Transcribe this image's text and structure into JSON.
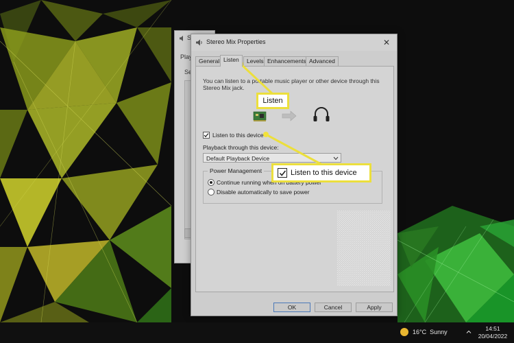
{
  "background_window": {
    "title": "S",
    "tab": "Play",
    "label": "Se"
  },
  "window": {
    "title": "Stereo Mix Properties",
    "close_icon": "close-icon"
  },
  "tabs": [
    {
      "label": "General",
      "active": false
    },
    {
      "label": "Listen",
      "active": true
    },
    {
      "label": "Levels",
      "active": false
    },
    {
      "label": "Enhancements",
      "active": false
    },
    {
      "label": "Advanced",
      "active": false
    }
  ],
  "listen_panel": {
    "description": "You can listen to a portable music player or other device through this Stereo Mix jack.",
    "listen_checkbox_label": "Listen to this device",
    "listen_checked": true,
    "playback_label": "Playback through this device:",
    "playback_value": "Default Playback Device",
    "power_group_title": "Power Management",
    "radio_options": [
      {
        "label": "Continue running when on battery power",
        "selected": true
      },
      {
        "label": "Disable automatically to save power",
        "selected": false
      }
    ]
  },
  "buttons": {
    "ok": "OK",
    "cancel": "Cancel",
    "apply": "Apply"
  },
  "callouts": {
    "listen": "Listen",
    "listen_to_device": "Listen to this device"
  },
  "taskbar": {
    "temperature": "16°C",
    "condition": "Sunny",
    "time": "14:51",
    "date": "20/04/2022"
  },
  "colors": {
    "callout_border": "#ecdf3c",
    "callout_dot": "#f2e23a",
    "wallpaper_yellow": "#c9cf2a",
    "wallpaper_green": "#2fbf3a"
  }
}
